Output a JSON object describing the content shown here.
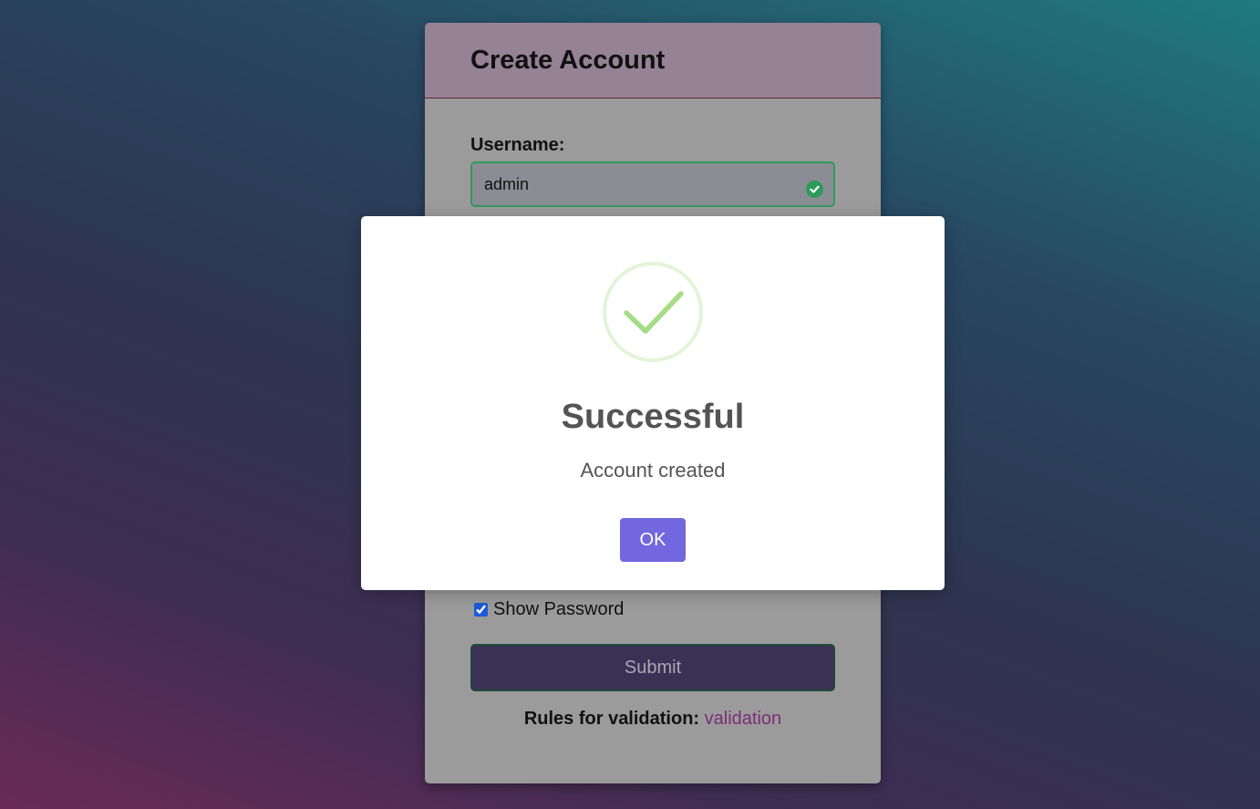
{
  "form": {
    "title": "Create Account",
    "username_label": "Username:",
    "username_value": "admin",
    "show_password_label": "Show Password",
    "show_password_checked": true,
    "submit_label": "Submit",
    "rules_label": "Rules for validation:",
    "rules_link": "validation"
  },
  "modal": {
    "icon": "success-check-icon",
    "title": "Successful",
    "message": "Account created",
    "ok_label": "OK"
  },
  "colors": {
    "valid_border": "#2f9a5b",
    "ok_button": "#7367e0",
    "success_check": "#a5dc86",
    "link": "#7a2e78"
  }
}
